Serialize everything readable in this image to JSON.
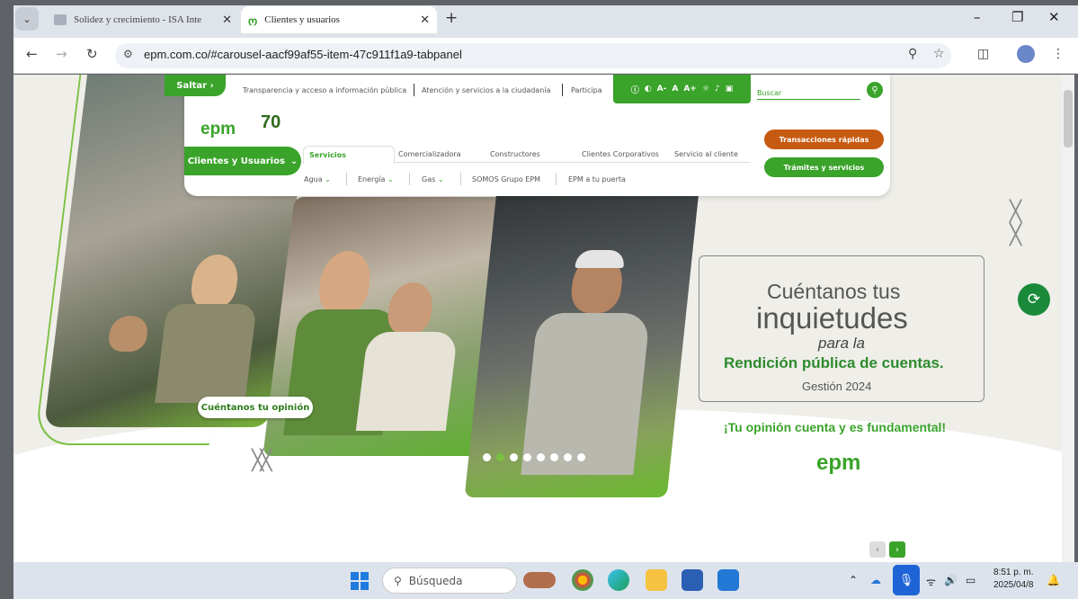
{
  "browser": {
    "tabs": [
      {
        "label": "Solidez y crecimiento - ISA Inte",
        "active": false
      },
      {
        "label": "Clientes y usuarios",
        "active": true
      }
    ],
    "url": "epm.com.co/#carousel-aacf99af55-item-47c911f1a9-tabpanel",
    "window_controls": {
      "minimize": "–",
      "maximize": "❐",
      "close": "✕"
    }
  },
  "header": {
    "skip_label": "Saltar",
    "top_links": [
      "Transparencia y acceso a información pública",
      "Atención y servicios a la ciudadanía",
      "Participa"
    ],
    "accessibility": [
      "A-",
      "A",
      "A+"
    ],
    "search_placeholder": "Buscar",
    "logo": "epm",
    "anniversary": "70",
    "audience_button": "Clientes y Usuarios",
    "tabs": [
      "Servicios",
      "Comercializadora",
      "Constructores",
      "Clientes Corporativos",
      "Servicio al cliente"
    ],
    "subnav": [
      "Agua",
      "Energía",
      "Gas",
      "SOMOS Grupo EPM",
      "EPM a tu puerta"
    ],
    "quick_transactions": "Transacciones rápidas",
    "procedures": "Trámites y servicios"
  },
  "hero": {
    "opinion_button": "Cuéntanos tu opinión",
    "line1": "Cuéntanos tus",
    "line2": "inquietudes",
    "line3": "para la",
    "line4": "Rendición pública de cuentas.",
    "line5": "Gestión 2024",
    "tagline": "¡Tu opinión cuenta y es fundamental!",
    "footer_logo": "epm",
    "carousel_dots": 8,
    "carousel_active": 1
  },
  "colors": {
    "brand_green": "#3aa32a",
    "accent_orange": "#c75a12"
  },
  "taskbar": {
    "search_label": "Búsqueda",
    "time": "8:51 p. m.",
    "date": "2025/04/8"
  }
}
